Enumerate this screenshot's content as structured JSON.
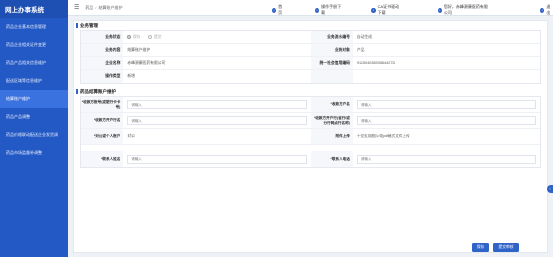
{
  "app": {
    "title": "网上办事系统"
  },
  "sidebar": {
    "items": [
      {
        "label": "药品企业基本信息管理",
        "active": false
      },
      {
        "label": "药品企业相关证件变更",
        "active": false
      },
      {
        "label": "药品产品相关信息维护",
        "active": false
      },
      {
        "label": "配送区域等信息维护",
        "active": false
      },
      {
        "label": "结算账户维护",
        "active": true
      },
      {
        "label": "药品产品调整",
        "active": false
      },
      {
        "label": "药品价格联动配送企业发货调",
        "active": false
      },
      {
        "label": "药品市场监督补调整",
        "active": false
      }
    ]
  },
  "header": {
    "breadcrumb": {
      "home": "药品",
      "sep": "/",
      "current": "结算账户维护"
    },
    "nav": [
      {
        "icon": "home-icon",
        "label": "首页"
      },
      {
        "icon": "manual-icon",
        "label": "操作手册下载"
      },
      {
        "icon": "ca-icon",
        "label": "CA证书驱动下载"
      },
      {
        "icon": "user-icon",
        "label": "您好，赤峰源康医药有限公司"
      },
      {
        "icon": "logout-icon",
        "label": "退出"
      }
    ]
  },
  "business": {
    "title": "业务管理",
    "rows": [
      {
        "l1": "业务状态",
        "radio1": "保存",
        "radio2": "提交",
        "l2": "业务流水编号",
        "v2": "自动生成"
      },
      {
        "l1": "业务内容",
        "v1": "结算账户维护",
        "l2": "业务对象",
        "v2": "产品"
      },
      {
        "l1": "企业名称",
        "v1": "赤峰源康医药有限公司",
        "l2": "统一社会信用编码",
        "v2": "91150403893564427D"
      },
      {
        "l1": "操作类型",
        "v1": "新增",
        "l2": "",
        "v2": ""
      }
    ]
  },
  "account": {
    "title": "药品结算账户维护",
    "rows": [
      {
        "l1": "*收款方账号(或银行卡卡号)",
        "p1": "请输入",
        "l2": "*收款方户名",
        "p2": "请输入"
      },
      {
        "l1": "*收款方开户行名",
        "p1": "请输入",
        "l2": "*收款方开户行(省行/或分行网点行名称)",
        "p2": "请输入"
      },
      {
        "l1": "*对公或个人账户",
        "v1": "对公",
        "l2": "附件上传",
        "v2": "十仅支持图片/或pdf格式文件上传"
      },
      {
        "l1": "*联系人姓名",
        "p1": "请输入",
        "l2": "*联系人电话",
        "p2": "请输入"
      }
    ]
  },
  "buttons": {
    "save": "保存",
    "submit": "提交审核"
  }
}
